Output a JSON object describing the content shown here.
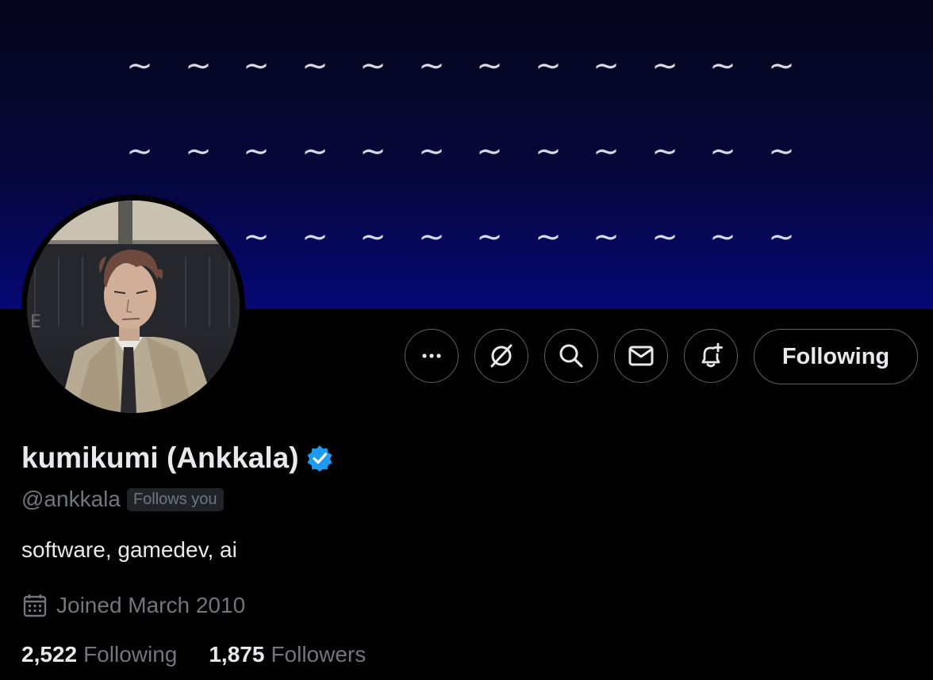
{
  "profile": {
    "display_name": "kumikumi (Ankkala)",
    "handle": "@ankkala",
    "follows_you_badge": "Follows you",
    "bio": "software, gamedev, ai",
    "joined": "Joined March 2010",
    "verified": true
  },
  "banner": {
    "tilde_char": "~",
    "background_colors": [
      "#05051a",
      "#060875"
    ]
  },
  "actions": {
    "more_icon": "more-horizontal-icon",
    "grok_icon": "grok-slash-icon",
    "search_icon": "search-icon",
    "message_icon": "envelope-icon",
    "notify_icon": "bell-plus-icon",
    "following_label": "Following"
  },
  "stats": {
    "following_count": "2,522",
    "following_label": "Following",
    "followers_count": "1,875",
    "followers_label": "Followers"
  },
  "colors": {
    "background": "#000000",
    "primary_text": "#e7e9ea",
    "secondary_text": "#71767b",
    "border": "#5c6166",
    "verified_blue": "#1d9bf0"
  }
}
